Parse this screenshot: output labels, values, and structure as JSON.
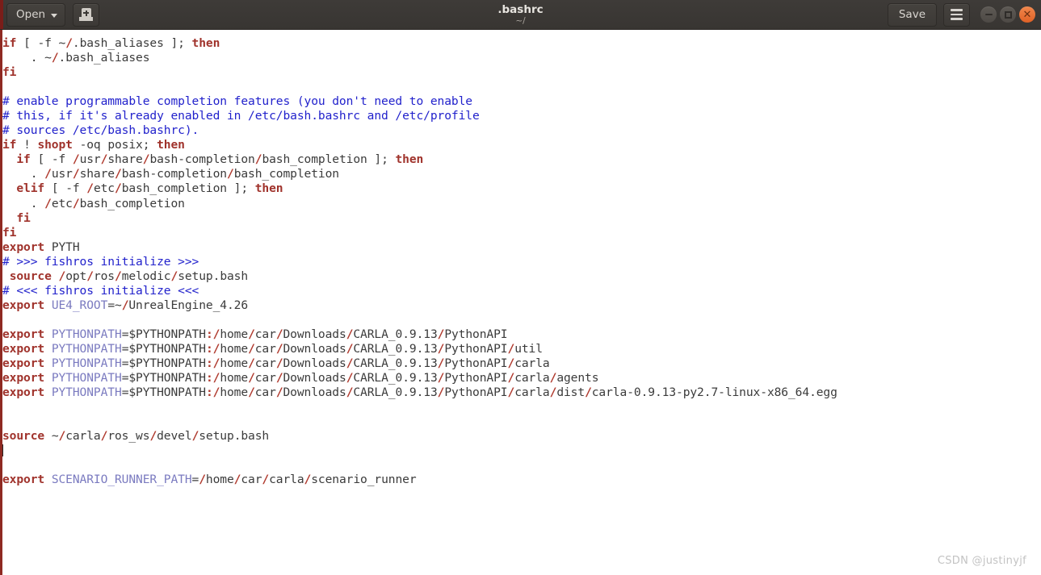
{
  "window": {
    "title": ".bashrc",
    "subtitle": "~/",
    "accent_color": "#8f2a22",
    "titlebar_color": "#3e3b38",
    "close_button_color": "#e06126"
  },
  "toolbar": {
    "open_label": "Open",
    "open_icon": "chevron-down-icon",
    "new_document_icon": "new-document-icon",
    "save_label": "Save",
    "menu_icon": "hamburger-menu-icon",
    "minimize_icon": "minimize-icon",
    "maximize_icon": "maximize-icon",
    "close_icon": "close-icon"
  },
  "editor": {
    "language": "bash",
    "colors": {
      "keyword": "#a0332c",
      "comment": "#2222cc",
      "separator": "#b03a2e",
      "variable": "#7b7bc0",
      "plain": "#3b3b3b",
      "background": "#ffffff"
    },
    "cursor_line": 28,
    "lines": [
      "if [ -f ~/.bash_aliases ]; then",
      "    . ~/.bash_aliases",
      "fi",
      "",
      "# enable programmable completion features (you don't need to enable",
      "# this, if it's already enabled in /etc/bash.bashrc and /etc/profile",
      "# sources /etc/bash.bashrc).",
      "if ! shopt -oq posix; then",
      "  if [ -f /usr/share/bash-completion/bash_completion ]; then",
      "    . /usr/share/bash-completion/bash_completion",
      "  elif [ -f /etc/bash_completion ]; then",
      "    . /etc/bash_completion",
      "  fi",
      "fi",
      "export PYTH",
      "# >>> fishros initialize >>>",
      " source /opt/ros/melodic/setup.bash",
      "# <<< fishros initialize <<<",
      "export UE4_ROOT=~/UnrealEngine_4.26",
      "",
      "export PYTHONPATH=$PYTHONPATH:/home/car/Downloads/CARLA_0.9.13/PythonAPI",
      "export PYTHONPATH=$PYTHONPATH:/home/car/Downloads/CARLA_0.9.13/PythonAPI/util",
      "export PYTHONPATH=$PYTHONPATH:/home/car/Downloads/CARLA_0.9.13/PythonAPI/carla",
      "export PYTHONPATH=$PYTHONPATH:/home/car/Downloads/CARLA_0.9.13/PythonAPI/carla/agents",
      "export PYTHONPATH=$PYTHONPATH:/home/car/Downloads/CARLA_0.9.13/PythonAPI/carla/dist/carla-0.9.13-py2.7-linux-x86_64.egg",
      "",
      "",
      "source ~/carla/ros_ws/devel/setup.bash",
      "",
      "",
      "export SCENARIO_RUNNER_PATH=/home/car/carla/scenario_runner"
    ]
  },
  "watermark": {
    "text": "CSDN @justinyjf"
  }
}
